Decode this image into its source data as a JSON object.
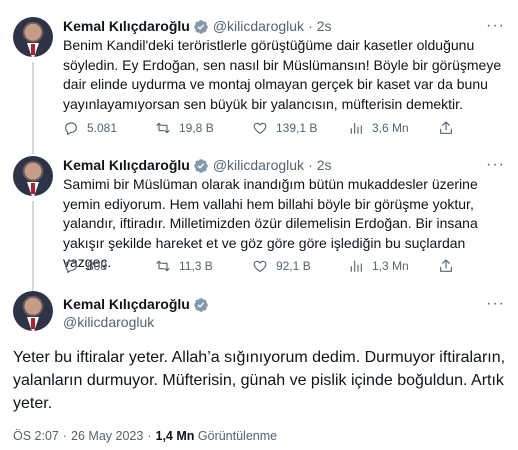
{
  "tweets": [
    {
      "author": "Kemal Kılıçdaroğlu",
      "handle": "@kilicdarogluk",
      "time": "2s",
      "text": "Benim Kandil'deki teröristlerle görüştüğüme dair kasetler olduğunu söyledin. Ey Erdoğan, sen nasıl bir Müslümansın! Böyle bir görüşmeye dair elinde uydurma ve montaj olmayan gerçek bir kaset var da bunu yayınlayamıyorsan sen büyük bir yalancısın, müfterisin demektir.",
      "replies": "5.081",
      "retweets": "19,8 B",
      "likes": "139,1 B",
      "views": "3,6 Mn"
    },
    {
      "author": "Kemal Kılıçdaroğlu",
      "handle": "@kilicdarogluk",
      "time": "2s",
      "text": "Samimi bir Müslüman olarak inandığım bütün mukaddesler üzerine yemin ediyorum. Hem vallahi hem billahi böyle bir görüşme yoktur, yalandır, iftiradır. Milletimizden özür dilemelisin Erdoğan. Bir insana yakışır şekilde hareket et ve göz göre göre işlediğin bu suçlardan vazgeç.",
      "replies": "808",
      "retweets": "11,3 B",
      "likes": "92,1 B",
      "views": "1,3 Mn"
    }
  ],
  "main": {
    "author": "Kemal Kılıçdaroğlu",
    "handle": "@kilicdarogluk",
    "text": "Yeter bu iftiralar yeter. Allah’a sığınıyorum dedim. Durmuyor iftiraların, yalanların durmuyor. Müfterisin, günah ve pislik içinde boğuldun. Artık yeter.",
    "time": "ÖS 2:07",
    "date": "26 May 2023",
    "views_count": "1,4 Mn",
    "views_label": "Görüntülenme"
  },
  "icons": {
    "reply": "reply-icon",
    "retweet": "retweet-icon",
    "like": "like-icon",
    "views": "views-icon",
    "share": "share-icon",
    "verified": "verified-icon",
    "more": "more-icon"
  },
  "colors": {
    "verified": "#829aab",
    "text": "#0f1419",
    "secondary": "#536471",
    "thread_line": "#cfd9de"
  }
}
